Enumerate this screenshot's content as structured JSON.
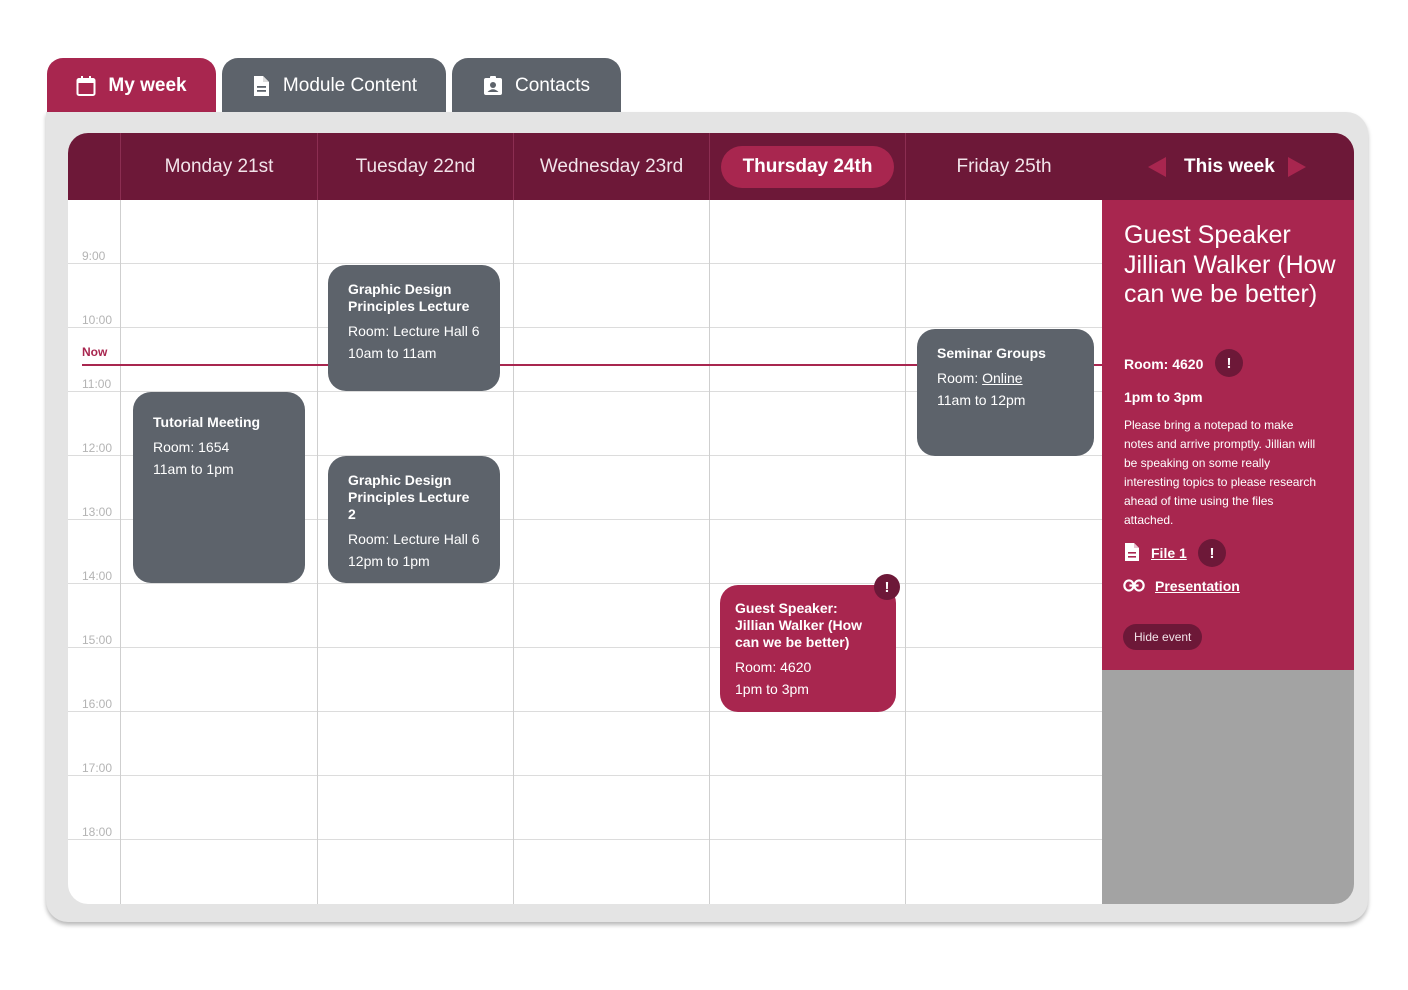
{
  "tabs": [
    {
      "label": "My week",
      "icon": "calendar-icon",
      "active": true
    },
    {
      "label": "Module Content",
      "icon": "document-icon",
      "active": false
    },
    {
      "label": "Contacts",
      "icon": "contact-card-icon",
      "active": false
    }
  ],
  "days": [
    {
      "label": "Monday 21st"
    },
    {
      "label": "Tuesday 22nd"
    },
    {
      "label": "Wednesday 23rd"
    },
    {
      "label": "Thursday 24th",
      "current": true
    },
    {
      "label": "Friday 25th"
    }
  ],
  "times": [
    "9:00",
    "10:00",
    "11:00",
    "12:00",
    "13:00",
    "14:00",
    "15:00",
    "16:00",
    "17:00",
    "18:00"
  ],
  "now_label": "Now",
  "events": {
    "tutorial": {
      "title": "Tutorial Meeting",
      "room": "Room: 1654",
      "time": "11am to 1pm"
    },
    "gd1": {
      "title": "Graphic Design Principles Lecture",
      "room": "Room: Lecture Hall 6",
      "time": "10am to 11am"
    },
    "gd2": {
      "title": "Graphic Design Principles Lecture 2",
      "room": "Room: Lecture Hall 6",
      "time": "12pm to 1pm"
    },
    "seminar": {
      "title": "Seminar Groups",
      "room_prefix": "Room: ",
      "room_link": "Online",
      "time": "11am to 12pm"
    },
    "guest": {
      "title": "Guest Speaker: Jillian Walker (How can we be better)",
      "room": "Room: 4620",
      "time": "1pm to 3pm",
      "alert": "!"
    }
  },
  "side": {
    "header": "This week",
    "title": "Guest Speaker Jillian Walker (How can we be better)",
    "room": "Room: 4620",
    "alert": "!",
    "time": "1pm to 3pm",
    "description": "Please bring a notepad to make notes and arrive promptly. Jillian will be speaking on some really interesting topics to please research ahead of time using the files attached.",
    "file_label": "File 1",
    "file_alert": "!",
    "link_label": "Presentation",
    "hide_button": "Hide event"
  },
  "colors": {
    "accent": "#a8264f",
    "header": "#6d1838",
    "event_grey": "#5d636b",
    "panel_grey": "#a3a3a3"
  }
}
